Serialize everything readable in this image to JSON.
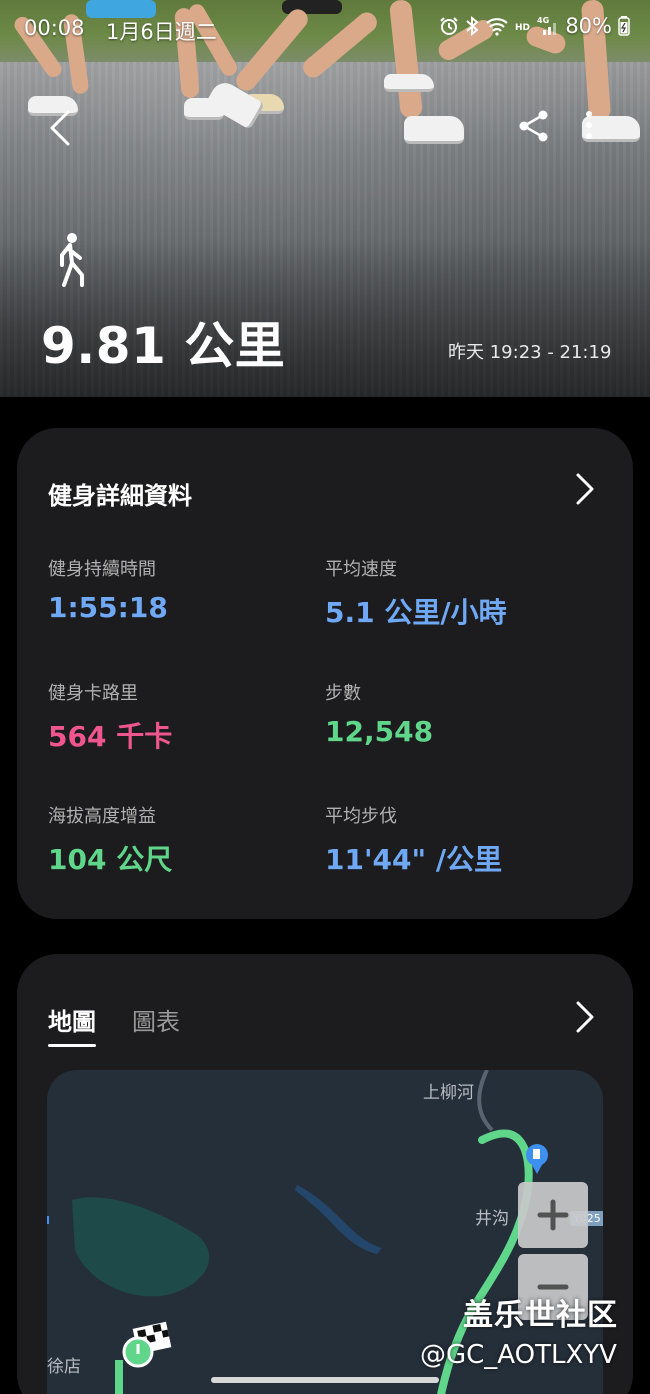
{
  "status_bar": {
    "time": "00:08",
    "date": "1月6日週二",
    "battery": "80%",
    "icons": [
      "alarm-icon",
      "bluetooth-icon",
      "wifi-icon",
      "hd-icon",
      "4g-signal-icon",
      "battery-icon"
    ]
  },
  "hero": {
    "activity_icon": "walking-icon",
    "distance": "9.81 公里",
    "time_range": "昨天 19:23 - 21:19",
    "actions": [
      "back-icon",
      "share-icon",
      "more-icon"
    ]
  },
  "details": {
    "title": "健身詳細資料",
    "stats": [
      {
        "label": "健身持續時間",
        "value": "1:55:18",
        "color": "#6fa8f5"
      },
      {
        "label": "平均速度",
        "value": "5.1 公里/小時",
        "color": "#6fa8f5"
      },
      {
        "label": "健身卡路里",
        "value": "564 千卡",
        "color": "#f0568e"
      },
      {
        "label": "步數",
        "value": "12,548",
        "color": "#5fd68a"
      },
      {
        "label": "海拔高度增益",
        "value": "104 公尺",
        "color": "#5fd68a"
      },
      {
        "label": "平均步伐",
        "value": "11'44\" /公里",
        "color": "#6fa8f5"
      }
    ]
  },
  "map_card": {
    "tabs": [
      {
        "label": "地圖",
        "active": true
      },
      {
        "label": "圖表",
        "active": false
      }
    ],
    "map_labels": {
      "village_top": "上柳河",
      "village_mid": "井沟",
      "village_bottom": "徐店",
      "road_code": "Y025"
    },
    "zoom_in": "+",
    "zoom_out": "−",
    "route_color": "#5fd68a"
  },
  "watermark": {
    "line1": "盖乐世社区",
    "line2": "@GC_AOTLXYV"
  }
}
